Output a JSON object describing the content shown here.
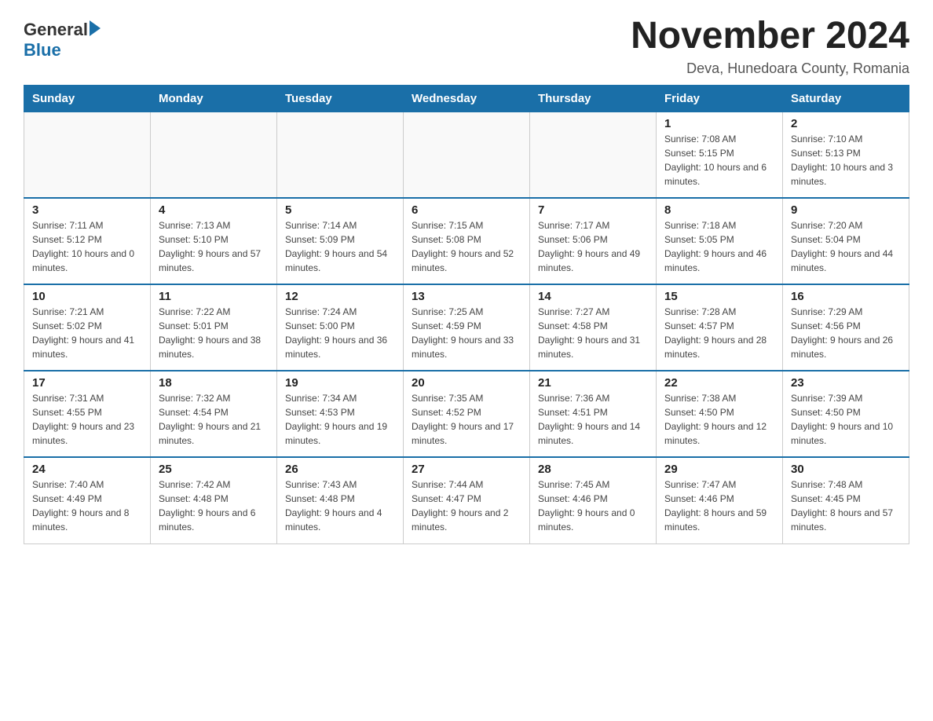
{
  "header": {
    "logo_general": "General",
    "logo_blue": "Blue",
    "title": "November 2024",
    "subtitle": "Deva, Hunedoara County, Romania"
  },
  "days_of_week": [
    "Sunday",
    "Monday",
    "Tuesday",
    "Wednesday",
    "Thursday",
    "Friday",
    "Saturday"
  ],
  "weeks": [
    [
      {
        "day": "",
        "info": ""
      },
      {
        "day": "",
        "info": ""
      },
      {
        "day": "",
        "info": ""
      },
      {
        "day": "",
        "info": ""
      },
      {
        "day": "",
        "info": ""
      },
      {
        "day": "1",
        "info": "Sunrise: 7:08 AM\nSunset: 5:15 PM\nDaylight: 10 hours and 6 minutes."
      },
      {
        "day": "2",
        "info": "Sunrise: 7:10 AM\nSunset: 5:13 PM\nDaylight: 10 hours and 3 minutes."
      }
    ],
    [
      {
        "day": "3",
        "info": "Sunrise: 7:11 AM\nSunset: 5:12 PM\nDaylight: 10 hours and 0 minutes."
      },
      {
        "day": "4",
        "info": "Sunrise: 7:13 AM\nSunset: 5:10 PM\nDaylight: 9 hours and 57 minutes."
      },
      {
        "day": "5",
        "info": "Sunrise: 7:14 AM\nSunset: 5:09 PM\nDaylight: 9 hours and 54 minutes."
      },
      {
        "day": "6",
        "info": "Sunrise: 7:15 AM\nSunset: 5:08 PM\nDaylight: 9 hours and 52 minutes."
      },
      {
        "day": "7",
        "info": "Sunrise: 7:17 AM\nSunset: 5:06 PM\nDaylight: 9 hours and 49 minutes."
      },
      {
        "day": "8",
        "info": "Sunrise: 7:18 AM\nSunset: 5:05 PM\nDaylight: 9 hours and 46 minutes."
      },
      {
        "day": "9",
        "info": "Sunrise: 7:20 AM\nSunset: 5:04 PM\nDaylight: 9 hours and 44 minutes."
      }
    ],
    [
      {
        "day": "10",
        "info": "Sunrise: 7:21 AM\nSunset: 5:02 PM\nDaylight: 9 hours and 41 minutes."
      },
      {
        "day": "11",
        "info": "Sunrise: 7:22 AM\nSunset: 5:01 PM\nDaylight: 9 hours and 38 minutes."
      },
      {
        "day": "12",
        "info": "Sunrise: 7:24 AM\nSunset: 5:00 PM\nDaylight: 9 hours and 36 minutes."
      },
      {
        "day": "13",
        "info": "Sunrise: 7:25 AM\nSunset: 4:59 PM\nDaylight: 9 hours and 33 minutes."
      },
      {
        "day": "14",
        "info": "Sunrise: 7:27 AM\nSunset: 4:58 PM\nDaylight: 9 hours and 31 minutes."
      },
      {
        "day": "15",
        "info": "Sunrise: 7:28 AM\nSunset: 4:57 PM\nDaylight: 9 hours and 28 minutes."
      },
      {
        "day": "16",
        "info": "Sunrise: 7:29 AM\nSunset: 4:56 PM\nDaylight: 9 hours and 26 minutes."
      }
    ],
    [
      {
        "day": "17",
        "info": "Sunrise: 7:31 AM\nSunset: 4:55 PM\nDaylight: 9 hours and 23 minutes."
      },
      {
        "day": "18",
        "info": "Sunrise: 7:32 AM\nSunset: 4:54 PM\nDaylight: 9 hours and 21 minutes."
      },
      {
        "day": "19",
        "info": "Sunrise: 7:34 AM\nSunset: 4:53 PM\nDaylight: 9 hours and 19 minutes."
      },
      {
        "day": "20",
        "info": "Sunrise: 7:35 AM\nSunset: 4:52 PM\nDaylight: 9 hours and 17 minutes."
      },
      {
        "day": "21",
        "info": "Sunrise: 7:36 AM\nSunset: 4:51 PM\nDaylight: 9 hours and 14 minutes."
      },
      {
        "day": "22",
        "info": "Sunrise: 7:38 AM\nSunset: 4:50 PM\nDaylight: 9 hours and 12 minutes."
      },
      {
        "day": "23",
        "info": "Sunrise: 7:39 AM\nSunset: 4:50 PM\nDaylight: 9 hours and 10 minutes."
      }
    ],
    [
      {
        "day": "24",
        "info": "Sunrise: 7:40 AM\nSunset: 4:49 PM\nDaylight: 9 hours and 8 minutes."
      },
      {
        "day": "25",
        "info": "Sunrise: 7:42 AM\nSunset: 4:48 PM\nDaylight: 9 hours and 6 minutes."
      },
      {
        "day": "26",
        "info": "Sunrise: 7:43 AM\nSunset: 4:48 PM\nDaylight: 9 hours and 4 minutes."
      },
      {
        "day": "27",
        "info": "Sunrise: 7:44 AM\nSunset: 4:47 PM\nDaylight: 9 hours and 2 minutes."
      },
      {
        "day": "28",
        "info": "Sunrise: 7:45 AM\nSunset: 4:46 PM\nDaylight: 9 hours and 0 minutes."
      },
      {
        "day": "29",
        "info": "Sunrise: 7:47 AM\nSunset: 4:46 PM\nDaylight: 8 hours and 59 minutes."
      },
      {
        "day": "30",
        "info": "Sunrise: 7:48 AM\nSunset: 4:45 PM\nDaylight: 8 hours and 57 minutes."
      }
    ]
  ]
}
